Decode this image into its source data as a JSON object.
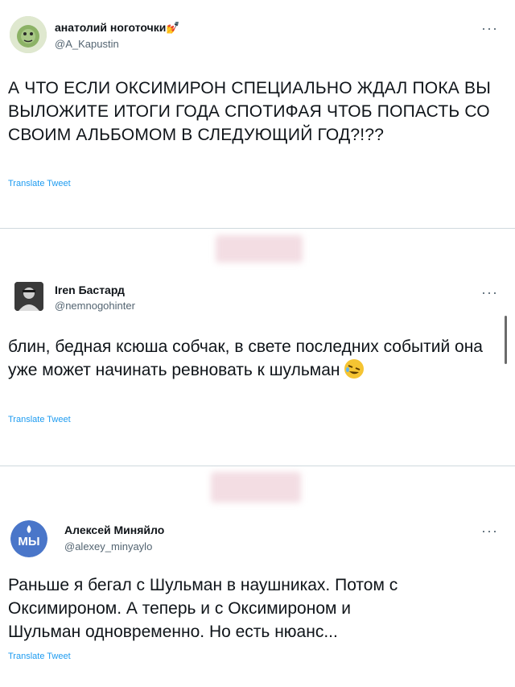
{
  "tweets": [
    {
      "name": "анатолий ноготочки💅",
      "handle": "@A_Kapustin",
      "text": "А ЧТО ЕСЛИ ОКСИМИРОН СПЕЦИАЛЬНО ЖДАЛ ПОКА ВЫ ВЫЛОЖИТЕ ИТОГИ ГОДА СПОТИФАЯ ЧТОБ ПОПАСТЬ СО СВОИМ АЛЬБОМОМ В СЛЕДУЮЩИЙ ГОД?!??",
      "translate": "Translate Tweet",
      "more": "···"
    },
    {
      "name": "Iren Бастард",
      "handle": "@nemnogohinter",
      "text": "блин, бедная ксюша собчак, в свете последних событий она уже может начинать ревновать к шульман",
      "translate": "Translate Tweet",
      "more": "···"
    },
    {
      "name": "Алексей Миняйло",
      "handle": "@alexey_minyaylo",
      "avatar_text": "МЫ",
      "text": "Раньше я бегал с Шульман в наушниках. Потом с Оксимироном. А теперь и с Оксимироном и Шульман одновременно. Но есть нюанс...",
      "translate": "Translate Tweet",
      "more": "···"
    }
  ],
  "colors": {
    "link": "#1d9bf0",
    "secondary_text": "#536471",
    "avatar3_bg": "#4a76c9"
  }
}
